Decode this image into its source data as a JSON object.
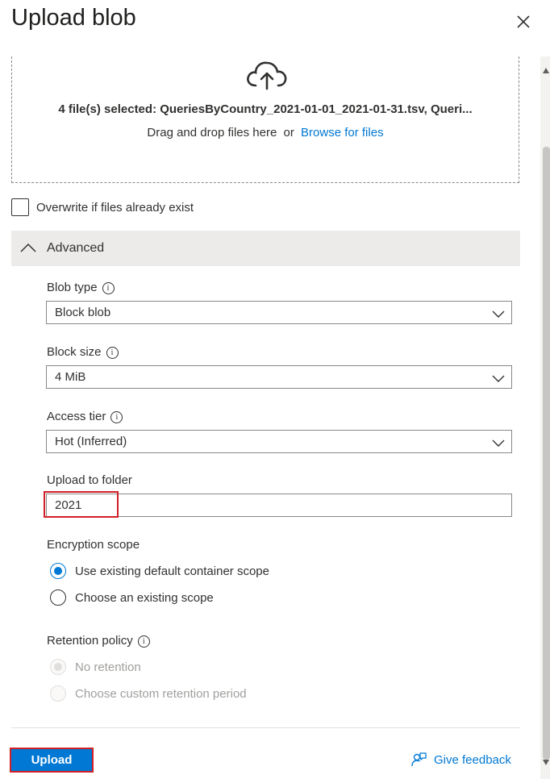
{
  "header": {
    "title": "Upload blob"
  },
  "dropzone": {
    "selected_text": "4 file(s) selected: QueriesByCountry_2021-01-01_2021-01-31.tsv, Queri...",
    "drag_text": "Drag and drop files here",
    "or_text": "or",
    "browse_label": "Browse for files"
  },
  "overwrite": {
    "label": "Overwrite if files already exist",
    "checked": false
  },
  "advanced": {
    "label": "Advanced",
    "expanded": true
  },
  "fields": {
    "blob_type": {
      "label": "Blob type",
      "value": "Block blob"
    },
    "block_size": {
      "label": "Block size",
      "value": "4 MiB"
    },
    "access_tier": {
      "label": "Access tier",
      "value": "Hot (Inferred)"
    },
    "upload_folder": {
      "label": "Upload to folder",
      "value": "2021"
    }
  },
  "encryption": {
    "label": "Encryption scope",
    "options": [
      {
        "label": "Use existing default container scope",
        "selected": true
      },
      {
        "label": "Choose an existing scope",
        "selected": false
      }
    ]
  },
  "retention": {
    "label": "Retention policy",
    "options": [
      {
        "label": "No retention",
        "selected": true,
        "disabled": true
      },
      {
        "label": "Choose custom retention period",
        "selected": false,
        "disabled": true
      }
    ]
  },
  "footer": {
    "upload_label": "Upload",
    "feedback_label": "Give feedback"
  },
  "colors": {
    "accent": "#0078d4",
    "highlight": "#d11f26"
  }
}
